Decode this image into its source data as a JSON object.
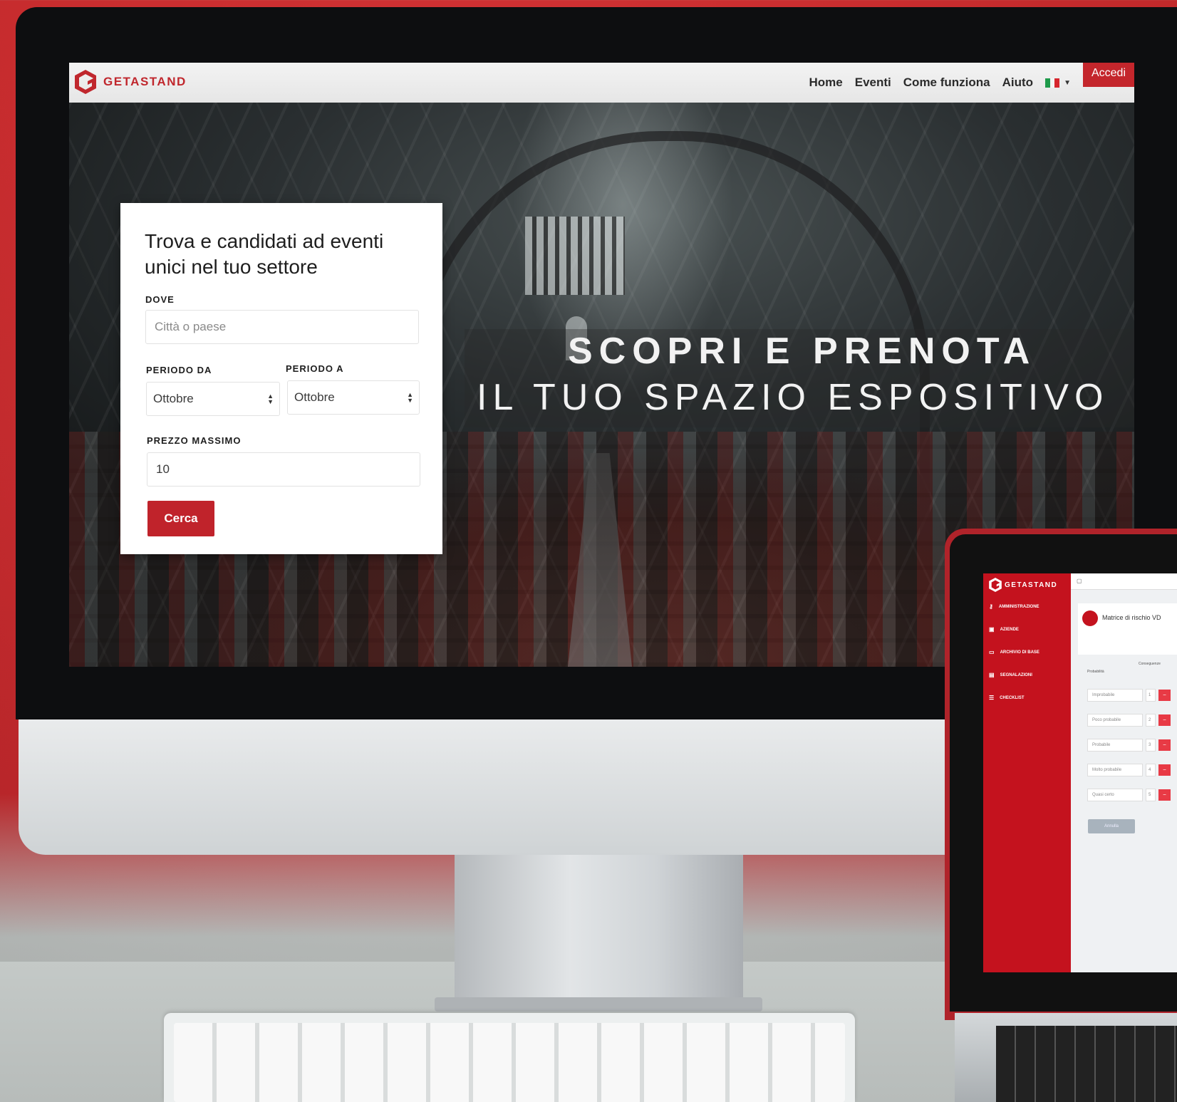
{
  "colors": {
    "brand_red": "#c0272d",
    "sidebar_red": "#c4121e",
    "delete_red": "#e83a45"
  },
  "site": {
    "logo_text": "GETASTAND",
    "nav": [
      "Home",
      "Eventi",
      "Come funziona",
      "Aiuto"
    ],
    "login_label": "Accedi"
  },
  "search": {
    "title": "Trova e candidati ad eventi unici nel tuo settore",
    "dove_label": "DOVE",
    "dove_placeholder": "Città o paese",
    "periodo_da_label": "PERIODO DA",
    "periodo_da_value": "Ottobre",
    "periodo_a_label": "PERIODO A",
    "periodo_a_value": "Ottobre",
    "prezzo_label": "PREZZO MASSIMO",
    "prezzo_value": "10",
    "submit_label": "Cerca"
  },
  "hero": {
    "line1": "SCOPRI E PRENOTA",
    "line2": "IL TUO SPAZIO ESPOSITIVO"
  },
  "admin": {
    "logo_text": "GETASTAND",
    "menu": [
      {
        "label": "AMMINISTRAZIONE",
        "icon": "key-icon"
      },
      {
        "label": "AZIENDE",
        "icon": "building-icon"
      },
      {
        "label": "ARCHIVIO DI BASE",
        "icon": "calendar-icon"
      },
      {
        "label": "SEGNALAZIONI",
        "icon": "comment-icon"
      },
      {
        "label": "CHECKLIST",
        "icon": "list-icon"
      }
    ],
    "card_title": "Matrice di rischio VD",
    "col_probabilita": "Probabilità",
    "col_conseguenze": "Conseguenze",
    "rows": [
      {
        "label": "Improbabile",
        "value": "1"
      },
      {
        "label": "Poco probabile",
        "value": "2"
      },
      {
        "label": "Probabile",
        "value": "3"
      },
      {
        "label": "Molto probabile",
        "value": "4"
      },
      {
        "label": "Quasi certo",
        "value": "5"
      }
    ],
    "cancel_label": "Annulla"
  }
}
